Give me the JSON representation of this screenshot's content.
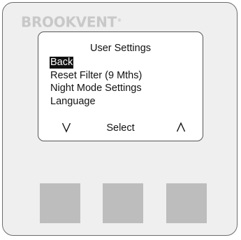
{
  "device": {
    "brand": "BROOKVENT",
    "trademark": "®",
    "colors": {
      "body": "#efefef",
      "brand_text": "#c8c8c8",
      "button": "#bdbdbd",
      "highlight": "#111111"
    }
  },
  "screen": {
    "title": "User Settings",
    "menu_items": [
      {
        "label": "Back",
        "selected": true
      },
      {
        "label": "Reset Filter (9 Mths)",
        "selected": false
      },
      {
        "label": "Night Mode Settings",
        "selected": false
      },
      {
        "label": "Language",
        "selected": false
      }
    ],
    "softkeys": {
      "left_icon": "chevron-down-icon",
      "center_label": "Select",
      "right_icon": "chevron-up-icon"
    }
  }
}
